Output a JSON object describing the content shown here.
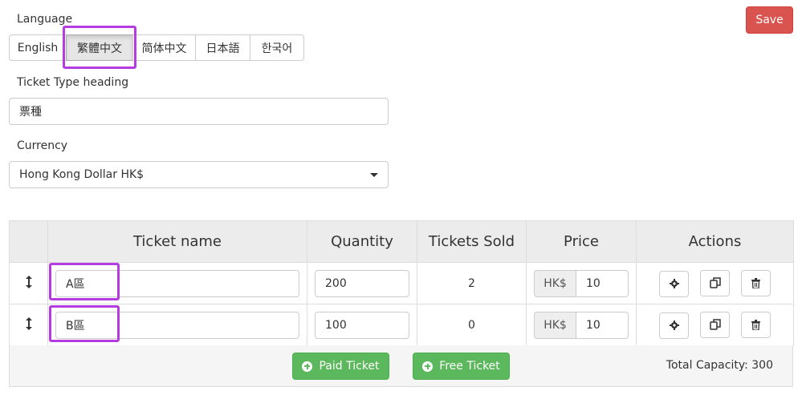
{
  "language": {
    "label": "Language",
    "options": [
      "English",
      "繁體中文",
      "简体中文",
      "日本語",
      "한국어"
    ],
    "selected": "繁體中文"
  },
  "save_label": "Save",
  "heading": {
    "label": "Ticket Type heading",
    "value": "票種"
  },
  "currency": {
    "label": "Currency",
    "value": "Hong Kong Dollar HK$"
  },
  "table": {
    "headers": [
      "Ticket name",
      "Quantity",
      "Tickets Sold",
      "Price",
      "Actions"
    ],
    "rows": [
      {
        "name": "A區",
        "quantity": "200",
        "sold": "2",
        "currency": "HK$",
        "price": "10"
      },
      {
        "name": "B區",
        "quantity": "100",
        "sold": "0",
        "currency": "HK$",
        "price": "10"
      }
    ]
  },
  "footer": {
    "paid_label": "Paid Ticket",
    "free_label": "Free Ticket",
    "total_capacity": "Total Capacity: 300"
  },
  "colors": {
    "danger": "#d9534f",
    "success": "#5cb85c",
    "highlight": "#b63be0"
  },
  "icons": [
    "sort-icon",
    "gear-icon",
    "copy-icon",
    "trash-icon",
    "plus-circle-icon",
    "caret-down-icon"
  ]
}
